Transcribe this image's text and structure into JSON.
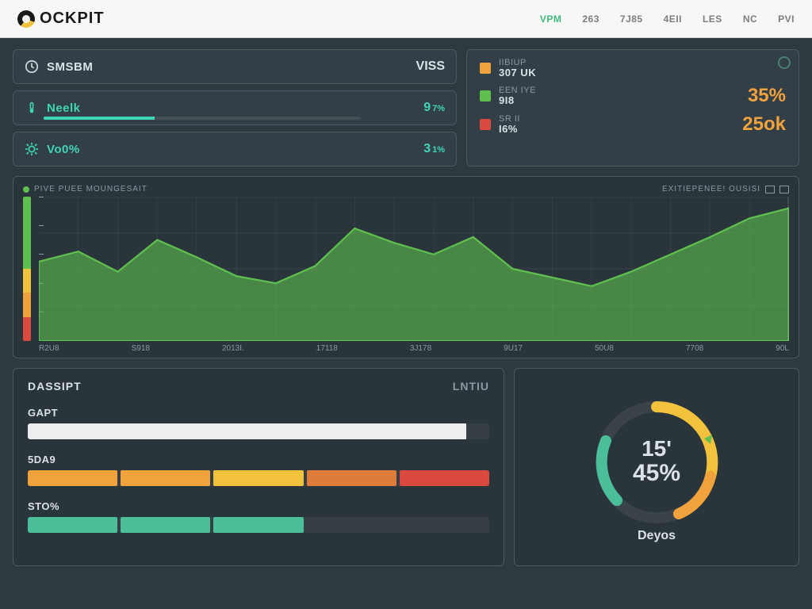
{
  "brand": "OCKPIT",
  "topnav": [
    "VPM",
    "263",
    "7J85",
    "4EII",
    "LES",
    "NC",
    "PVI"
  ],
  "topnav_active_index": 0,
  "metrics": [
    {
      "label": "SMSBM",
      "value": "VISS",
      "white_label": true,
      "white_val": true,
      "progress": 0
    },
    {
      "label": "Neelk",
      "value": "9",
      "unit": "7%",
      "progress": 35
    },
    {
      "label": "Vo0%",
      "value": "3",
      "unit": "1%",
      "progress": 0
    }
  ],
  "status": {
    "rows": [
      {
        "swatch": "orange",
        "small": "IIBIUP",
        "big": "307 UK",
        "pct": ""
      },
      {
        "swatch": "green",
        "small": "EEN IYE",
        "big": "9I8",
        "pct": "35%"
      },
      {
        "swatch": "red",
        "small": "SR II",
        "big": "I6%",
        "pct": "25ok"
      }
    ]
  },
  "chart": {
    "title": "PIVE PUEE MOUNGESAIT",
    "right_label": "EXITIEPENEE! OUSISI",
    "xticks": [
      "R2U8",
      "S918",
      "2013I.",
      "17118",
      "3J178",
      "9U17",
      "50U8",
      "7708",
      "90L"
    ]
  },
  "chart_data": {
    "type": "area",
    "x": [
      0,
      1,
      2,
      3,
      4,
      5,
      6,
      7,
      8,
      9,
      10,
      11,
      12,
      13,
      14,
      15,
      16,
      17,
      18,
      19
    ],
    "values": [
      55,
      62,
      48,
      70,
      58,
      45,
      40,
      52,
      78,
      68,
      60,
      72,
      50,
      44,
      38,
      48,
      60,
      72,
      85,
      92
    ],
    "ylim": [
      0,
      100
    ],
    "title": "PIVE PUEE MOUNGESAIT",
    "xlabel": "",
    "ylabel": ""
  },
  "progress_panel": {
    "title_left": "DASSIPT",
    "title_right": "LNTIU",
    "rows": [
      {
        "label": "GAPT",
        "type": "single",
        "fill": 95,
        "color": "#eeeeee"
      },
      {
        "label": "5DA9",
        "type": "segments",
        "colors": [
          "#f2a23c",
          "#f2a23c",
          "#f2c23c",
          "#e07c3a",
          "#d9493e"
        ]
      },
      {
        "label": "STO%",
        "type": "segments",
        "colors": [
          "#4bbf9a",
          "#4bbf9a",
          "#4bbf9a",
          "",
          ""
        ]
      }
    ]
  },
  "gauge": {
    "top": "15'",
    "main": "45%",
    "caption": "Deyos"
  }
}
